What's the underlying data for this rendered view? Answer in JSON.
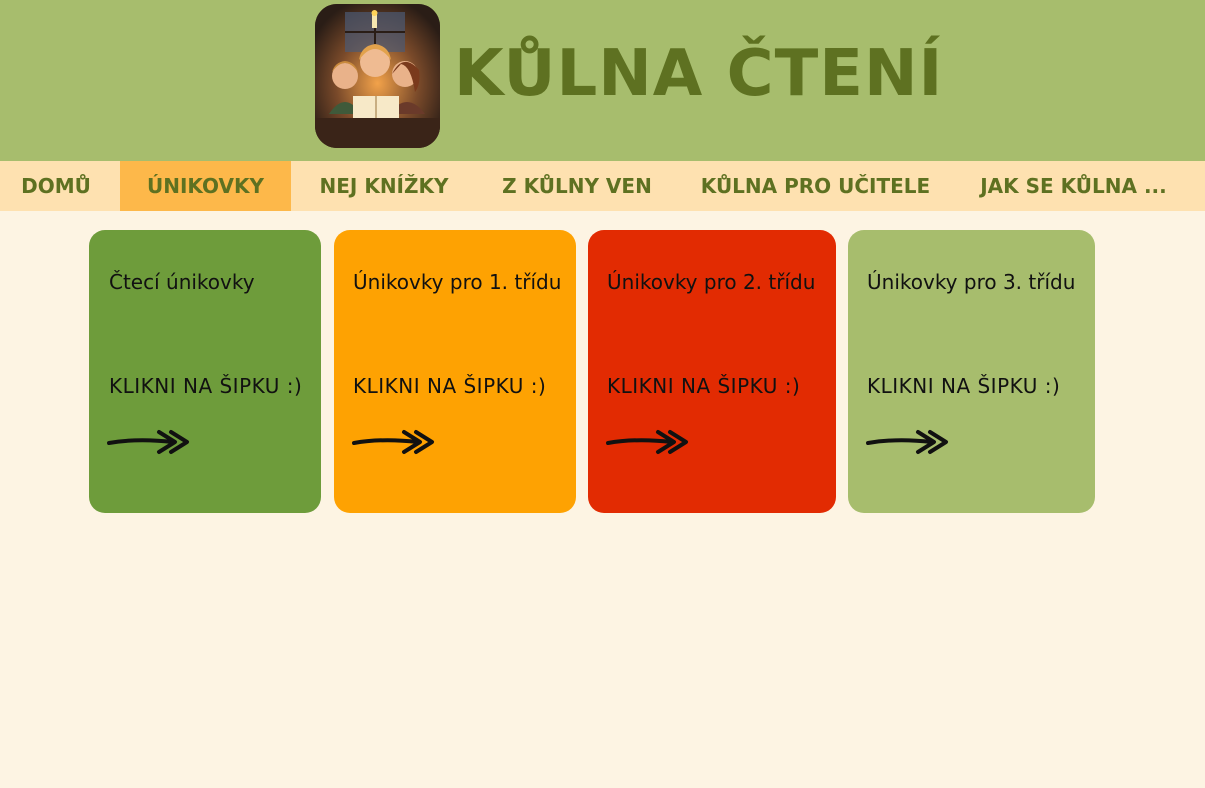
{
  "header": {
    "logo_alt": "children reading a book by candlelight",
    "title": "KŮLNA ČTENÍ",
    "bg_color": "#a7bd6d",
    "title_color": "#5e7121"
  },
  "nav": {
    "items": [
      {
        "label": "DOMŮ"
      },
      {
        "label": "ÚNIKOVKY",
        "active": true
      },
      {
        "label": "NEJ KNÍŽKY"
      },
      {
        "label": "Z KŮLNY VEN"
      },
      {
        "label": "KŮLNA PRO UČITELE"
      },
      {
        "label": "JAK SE KŮLNA ..."
      }
    ],
    "bg_color": "#fee1b0",
    "active_color": "#fdb84a"
  },
  "cards": [
    {
      "title": "Čtecí únikovky",
      "cta": "KLIKNI NA ŠIPKU :)",
      "icon": "arrow-right-icon",
      "color": "#6e9c3b"
    },
    {
      "title": "Únikovky pro 1. třídu",
      "cta": "KLIKNI NA ŠIPKU :)",
      "icon": "arrow-right-icon",
      "color": "#fea202"
    },
    {
      "title": "Únikovky pro 2. třídu",
      "cta": "KLIKNI NA ŠIPKU :)",
      "icon": "arrow-right-icon",
      "color": "#e22b02"
    },
    {
      "title": "Únikovky pro 3. třídu",
      "cta": "KLIKNI NA ŠIPKU :)",
      "icon": "arrow-right-icon",
      "color": "#a7bd6d"
    }
  ],
  "page_bg": "#fdf4e3"
}
